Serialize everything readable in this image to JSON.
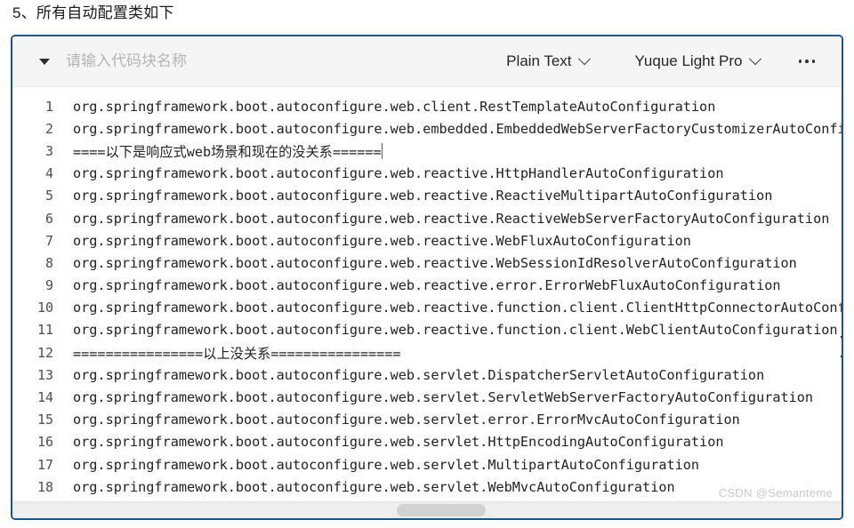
{
  "page": {
    "heading": "5、所有自动配置类如下"
  },
  "toolbar": {
    "collapse_icon": "caret-down-icon",
    "title_value": "",
    "title_placeholder": "请输入代码块名称",
    "language_label": "Plain Text",
    "theme_label": "Yuque Light Pro",
    "more_label": "…",
    "chevron_icon": "chevron-down-icon"
  },
  "editor": {
    "lines": [
      {
        "no": "1",
        "text": "org.springframework.boot.autoconfigure.web.client.RestTemplateAutoConfiguration"
      },
      {
        "no": "2",
        "text": "org.springframework.boot.autoconfigure.web.embedded.EmbeddedWebServerFactoryCustomizerAutoConfiguration"
      },
      {
        "no": "3",
        "text": "====以下是响应式web场景和现在的没关系======"
      },
      {
        "no": "4",
        "text": "org.springframework.boot.autoconfigure.web.reactive.HttpHandlerAutoConfiguration"
      },
      {
        "no": "5",
        "text": "org.springframework.boot.autoconfigure.web.reactive.ReactiveMultipartAutoConfiguration"
      },
      {
        "no": "6",
        "text": "org.springframework.boot.autoconfigure.web.reactive.ReactiveWebServerFactoryAutoConfiguration"
      },
      {
        "no": "7",
        "text": "org.springframework.boot.autoconfigure.web.reactive.WebFluxAutoConfiguration"
      },
      {
        "no": "8",
        "text": "org.springframework.boot.autoconfigure.web.reactive.WebSessionIdResolverAutoConfiguration"
      },
      {
        "no": "9",
        "text": "org.springframework.boot.autoconfigure.web.reactive.error.ErrorWebFluxAutoConfiguration"
      },
      {
        "no": "10",
        "text": "org.springframework.boot.autoconfigure.web.reactive.function.client.ClientHttpConnectorAutoConfiguration"
      },
      {
        "no": "11",
        "text": "org.springframework.boot.autoconfigure.web.reactive.function.client.WebClientAutoConfiguration"
      },
      {
        "no": "12",
        "text": "================以上没关系================"
      },
      {
        "no": "13",
        "text": "org.springframework.boot.autoconfigure.web.servlet.DispatcherServletAutoConfiguration"
      },
      {
        "no": "14",
        "text": "org.springframework.boot.autoconfigure.web.servlet.ServletWebServerFactoryAutoConfiguration"
      },
      {
        "no": "15",
        "text": "org.springframework.boot.autoconfigure.web.servlet.error.ErrorMvcAutoConfiguration"
      },
      {
        "no": "16",
        "text": "org.springframework.boot.autoconfigure.web.servlet.HttpEncodingAutoConfiguration"
      },
      {
        "no": "17",
        "text": "org.springframework.boot.autoconfigure.web.servlet.MultipartAutoConfiguration"
      },
      {
        "no": "18",
        "text": "org.springframework.boot.autoconfigure.web.servlet.WebMvcAutoConfiguration"
      }
    ],
    "caret_on_line": "3"
  },
  "watermark": {
    "text": "CSDN @Semanteme"
  },
  "colors": {
    "border": "#17568f",
    "toolbar_bg": "#f5f5f5",
    "caret": "#1a6fc4",
    "scrollbar_thumb": "#d2d2d2",
    "watermark": "#c9c9c9"
  }
}
